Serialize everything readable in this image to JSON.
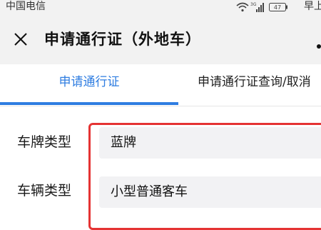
{
  "status_bar": {
    "carrier": "中国电信",
    "network": "3G",
    "battery": "47",
    "time": "早上"
  },
  "nav": {
    "title": "申请通行证（外地车）",
    "close_icon": "close-icon",
    "more_icon": "more-icon"
  },
  "tabs": [
    {
      "label": "申请通行证",
      "active": true
    },
    {
      "label": "申请通行证查询/取消",
      "active": false
    }
  ],
  "form": {
    "plate_type_label": "车牌类型",
    "plate_type_value": "蓝牌",
    "vehicle_type_label": "车辆类型",
    "vehicle_type_value": "小型普通客车"
  },
  "colors": {
    "accent": "#2f7de1",
    "highlight": "#e53333",
    "header_bg": "#f2f2f2",
    "field_bg": "#f2f2f4"
  }
}
